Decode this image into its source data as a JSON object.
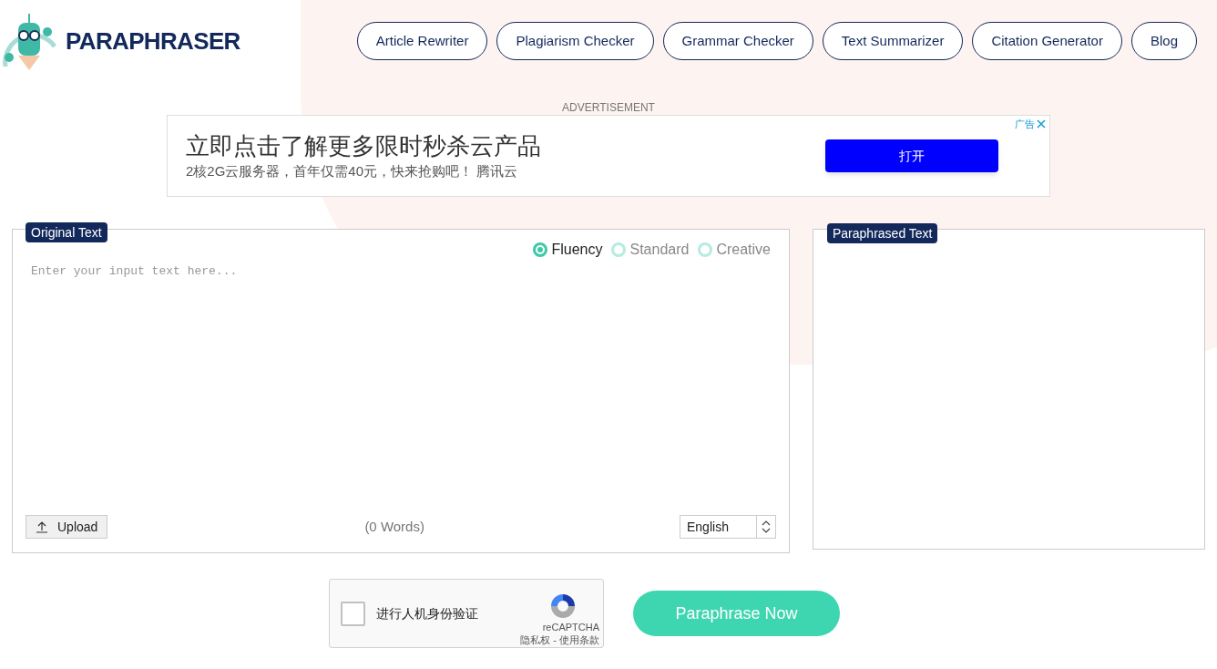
{
  "brand": {
    "name": "PARAPHRASER"
  },
  "nav": [
    "Article Rewriter",
    "Plagiarism Checker",
    "Grammar Checker",
    "Text Summarizer",
    "Citation Generator",
    "Blog"
  ],
  "ad": {
    "label": "ADVERTISEMENT",
    "headline": "立即点击了解更多限时秒杀云产品",
    "subline": "2核2G云服务器，首年仅需40元，快来抢购吧！ 腾讯云",
    "button": "打开",
    "tag": "广告"
  },
  "original": {
    "title": "Original Text",
    "modes": [
      {
        "label": "Fluency",
        "selected": true
      },
      {
        "label": "Standard",
        "selected": false
      },
      {
        "label": "Creative",
        "selected": false
      }
    ],
    "placeholder": "Enter your input text here...",
    "upload": "Upload",
    "word_count": "(0 Words)",
    "language": "English"
  },
  "paraphrased": {
    "title": "Paraphrased Text"
  },
  "captcha": {
    "checked": false,
    "label": "进行人机身份验证",
    "brand": "reCAPTCHA",
    "links": "隐私权 - 使用条款"
  },
  "submit": "Paraphrase Now"
}
